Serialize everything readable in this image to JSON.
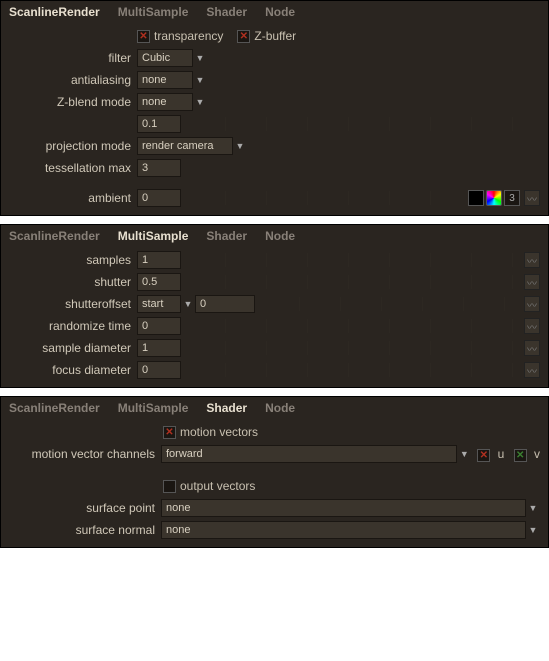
{
  "tabs": {
    "scanline": "ScanlineRender",
    "multi": "MultiSample",
    "shader": "Shader",
    "node": "Node"
  },
  "panel1": {
    "transparency_label": "transparency",
    "zbuffer_label": "Z-buffer",
    "filter_label": "filter",
    "filter_value": "Cubic",
    "antialiasing_label": "antialiasing",
    "antialiasing_value": "none",
    "zblendmode_label": "Z-blend mode",
    "zblendmode_value": "none",
    "zblendrange_value": "0.1",
    "projectionmode_label": "projection mode",
    "projectionmode_value": "render camera",
    "tessmax_label": "tessellation max",
    "tessmax_value": "3",
    "ambient_label": "ambient",
    "ambient_value": "0",
    "ambient_count": "3"
  },
  "panel2": {
    "samples_label": "samples",
    "samples_value": "1",
    "shutter_label": "shutter",
    "shutter_value": "0.5",
    "shutteroffset_label": "shutteroffset",
    "shutteroffset_select": "start",
    "shutteroffset_value": "0",
    "randomize_label": "randomize time",
    "randomize_value": "0",
    "sampledia_label": "sample diameter",
    "sampledia_value": "1",
    "focusdia_label": "focus diameter",
    "focusdia_value": "0"
  },
  "panel3": {
    "motionvec_label": "motion vectors",
    "mvchannels_label": "motion vector channels",
    "mvchannels_value": "forward",
    "u_label": "u",
    "v_label": "v",
    "outputvec_label": "output vectors",
    "surfacepoint_label": "surface point",
    "surfacepoint_value": "none",
    "surfacenormal_label": "surface normal",
    "surfacenormal_value": "none"
  }
}
